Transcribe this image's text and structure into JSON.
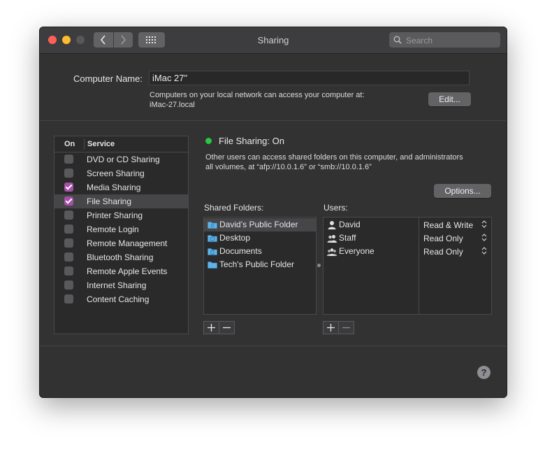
{
  "window": {
    "title": "Sharing"
  },
  "toolbar": {
    "search_placeholder": "Search"
  },
  "computer_name": {
    "label": "Computer Name:",
    "value": "iMac 27\"",
    "description_line1": "Computers on your local network can access your computer at:",
    "description_line2": "iMac-27.local",
    "edit_label": "Edit..."
  },
  "services": {
    "header_on": "On",
    "header_service": "Service",
    "items": [
      {
        "name": "DVD or CD Sharing",
        "checked": false,
        "selected": false
      },
      {
        "name": "Screen Sharing",
        "checked": false,
        "selected": false
      },
      {
        "name": "Media Sharing",
        "checked": true,
        "selected": false
      },
      {
        "name": "File Sharing",
        "checked": true,
        "selected": true
      },
      {
        "name": "Printer Sharing",
        "checked": false,
        "selected": false
      },
      {
        "name": "Remote Login",
        "checked": false,
        "selected": false
      },
      {
        "name": "Remote Management",
        "checked": false,
        "selected": false
      },
      {
        "name": "Bluetooth Sharing",
        "checked": false,
        "selected": false
      },
      {
        "name": "Remote Apple Events",
        "checked": false,
        "selected": false
      },
      {
        "name": "Internet Sharing",
        "checked": false,
        "selected": false
      },
      {
        "name": "Content Caching",
        "checked": false,
        "selected": false
      }
    ]
  },
  "file_sharing": {
    "status": "File Sharing: On",
    "status_color": "#2ac840",
    "description_line1": "Other users can access shared folders on this computer, and administrators",
    "description_line2": "all volumes, at “afp://10.0.1.6” or “smb://10.0.1.6”",
    "options_label": "Options...",
    "shared_folders_label": "Shared Folders:",
    "users_label": "Users:",
    "folders": [
      {
        "name": "David’s Public Folder",
        "icon": "public-folder-icon",
        "selected": true
      },
      {
        "name": "Desktop",
        "icon": "desktop-folder-icon",
        "selected": false
      },
      {
        "name": "Documents",
        "icon": "documents-folder-icon",
        "selected": false
      },
      {
        "name": "Tech's Public Folder",
        "icon": "folder-icon",
        "selected": false
      }
    ],
    "users": [
      {
        "name": "David",
        "icon": "user-icon",
        "permission": "Read & Write"
      },
      {
        "name": "Staff",
        "icon": "group-icon",
        "permission": "Read Only"
      },
      {
        "name": "Everyone",
        "icon": "everyone-icon",
        "permission": "Read Only"
      }
    ]
  },
  "colors": {
    "accent_checkbox": "#a550a7",
    "background": "#323232"
  }
}
